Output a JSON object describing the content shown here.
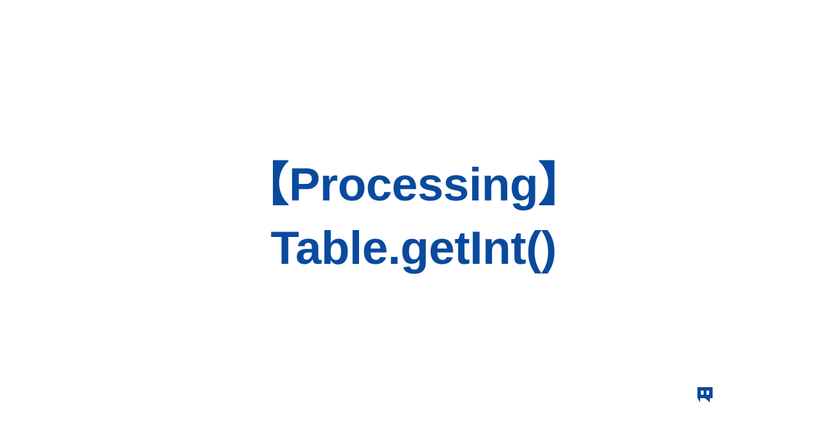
{
  "title": {
    "line1": "【Processing】",
    "line2": "Table.getInt()"
  },
  "colors": {
    "title": "#0a4a9e",
    "logo": "#0a4a9e",
    "background": "#ffffff"
  },
  "logo": {
    "name": "brand-mark"
  }
}
